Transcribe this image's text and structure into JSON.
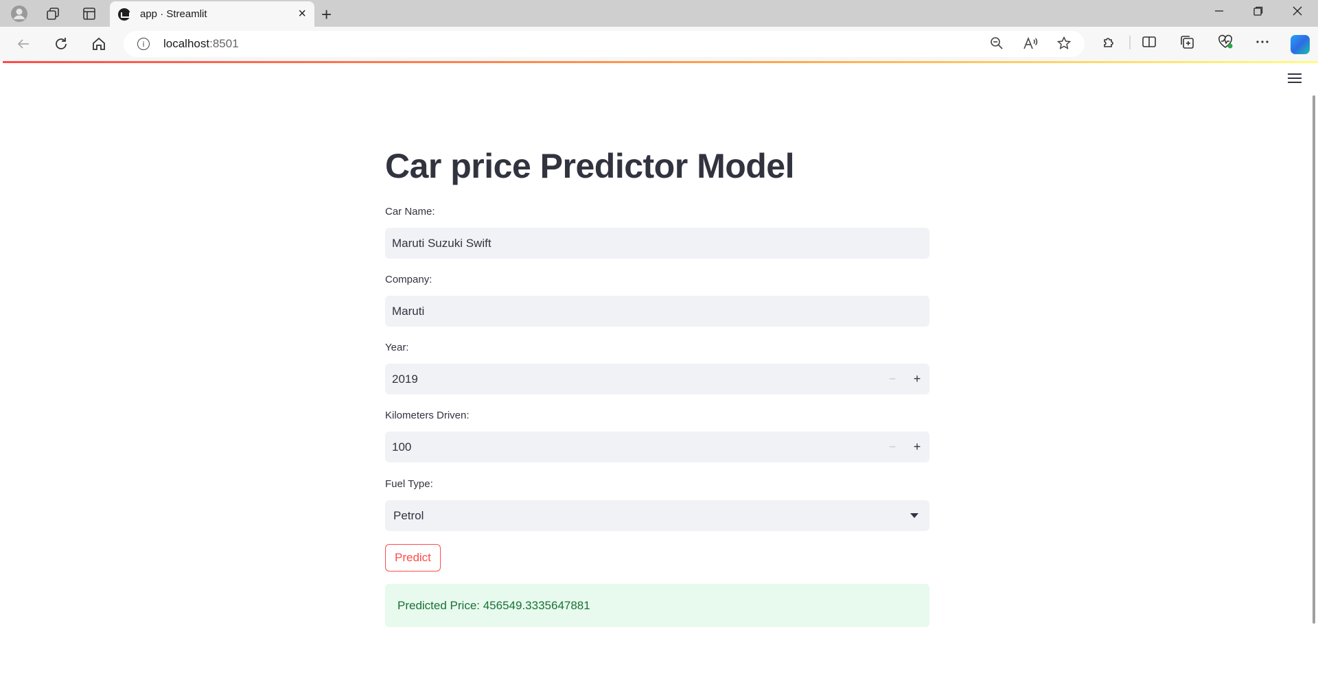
{
  "browser": {
    "tab_title": "app · Streamlit",
    "tab_close": "×",
    "new_tab": "+",
    "url_host": "localhost",
    "url_port": ":8501"
  },
  "app": {
    "title": "Car price Predictor Model",
    "fields": {
      "car_name": {
        "label": "Car Name:",
        "value": "Maruti Suzuki Swift"
      },
      "company": {
        "label": "Company:",
        "value": "Maruti"
      },
      "year": {
        "label": "Year:",
        "value": "2019"
      },
      "kms": {
        "label": "Kilometers Driven:",
        "value": "100"
      },
      "fuel": {
        "label": "Fuel Type:",
        "value": "Petrol"
      }
    },
    "stepper": {
      "minus": "−",
      "plus": "+"
    },
    "predict_label": "Predict",
    "result_text": "Predicted Price: 456549.3335647881"
  },
  "colors": {
    "primary": "#ff4b4b",
    "input_bg": "#f0f2f6",
    "text": "#31333f",
    "success_bg": "#e8f9ee",
    "success_text": "#177233"
  },
  "icons": [
    "profile-icon",
    "workspaces-icon",
    "tab-actions-icon",
    "streamlit-favicon",
    "back-icon",
    "refresh-icon",
    "home-icon",
    "site-info-icon",
    "zoom-icon",
    "read-aloud-icon",
    "favorite-star-icon",
    "extensions-icon",
    "split-screen-icon",
    "collections-icon",
    "browser-essentials-icon",
    "more-icon",
    "copilot-icon",
    "hamburger-menu-icon",
    "dropdown-caret-icon"
  ]
}
